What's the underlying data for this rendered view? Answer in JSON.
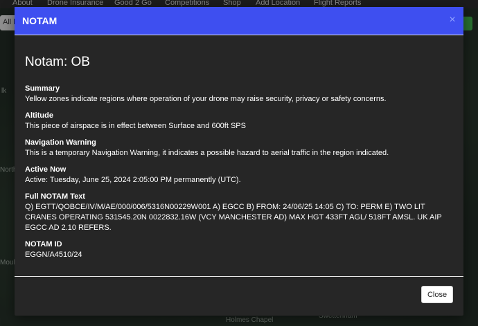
{
  "background": {
    "nav_items": [
      "About",
      "Drone Insurance",
      "Good 2 Go",
      "Competitions",
      "Shop",
      "Add Location",
      "Flight Reports"
    ],
    "search_fragment": "All l",
    "map_labels": [
      "lk",
      "North",
      "Moult",
      "Holmes Chapel",
      "Swettenham"
    ]
  },
  "modal": {
    "header_title": "NOTAM",
    "close_x": "×",
    "heading": "Notam: OB",
    "sections": [
      {
        "label": "Summary",
        "text": "Yellow zones indicate regions where operation of your drone may raise security, privacy or safety concerns."
      },
      {
        "label": "Altitude",
        "text": "This piece of airspace is in effect between Surface and 600ft SPS"
      },
      {
        "label": "Navigation Warning",
        "text": "This is a temporary Navigation Warning, it indicates a possible hazard to aerial traffic in the region indicated."
      },
      {
        "label": "Active Now",
        "text": "Active: Tuesday, June 25, 2024 2:05:00 PM permanently (UTC)."
      },
      {
        "label": "Full NOTAM Text",
        "text": "Q) EGTT/QOBCE/IV/M/AE/000/006/5316N00229W001 A) EGCC B) FROM: 24/06/25 14:05 C) TO: PERM E) TWO LIT CRANES OPERATING 531545.20N 0022832.16W (VCY MANCHESTER AD) MAX HGT 433FT AGL/ 518FT AMSL. UK AIP EGCC AD 2.10 REFERS."
      },
      {
        "label": "NOTAM ID",
        "text": "EGGN/A4510/24"
      }
    ],
    "close_button": "Close"
  },
  "colors": {
    "header_accent": "#3e4ff0",
    "modal_bg": "#262626"
  }
}
